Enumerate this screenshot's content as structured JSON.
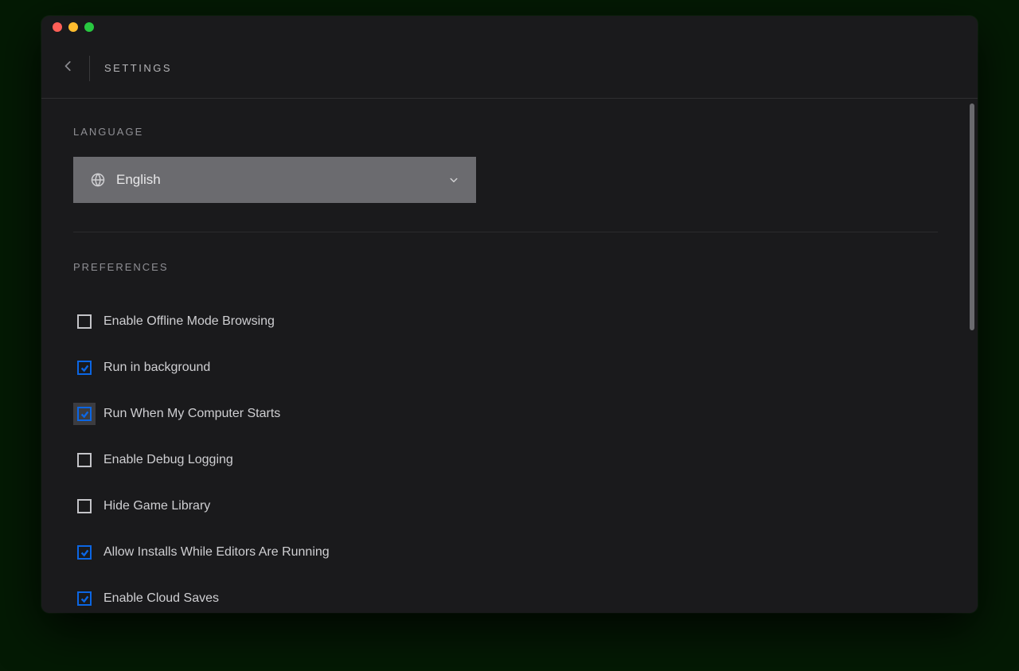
{
  "header": {
    "title": "SETTINGS"
  },
  "language": {
    "section_label": "LANGUAGE",
    "selected": "English"
  },
  "preferences": {
    "section_label": "PREFERENCES",
    "items": [
      {
        "label": "Enable Offline Mode Browsing",
        "checked": false,
        "focused": false
      },
      {
        "label": "Run in background",
        "checked": true,
        "focused": false
      },
      {
        "label": "Run When My Computer Starts",
        "checked": true,
        "focused": true
      },
      {
        "label": "Enable Debug Logging",
        "checked": false,
        "focused": false
      },
      {
        "label": "Hide Game Library",
        "checked": false,
        "focused": false
      },
      {
        "label": "Allow Installs While Editors Are Running",
        "checked": true,
        "focused": false
      },
      {
        "label": "Enable Cloud Saves",
        "checked": true,
        "focused": false
      }
    ]
  }
}
